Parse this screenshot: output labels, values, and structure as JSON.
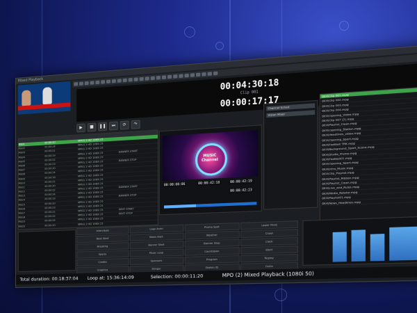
{
  "window": {
    "title": "Mixed Playback"
  },
  "timecodes": {
    "elapsed": "00:04:30:18",
    "clip_label": "Clip 001",
    "remaining": "00:00:17:17"
  },
  "transport": {
    "play": "▶",
    "stop": "■",
    "pause": "❚❚",
    "next": "⏭",
    "loop": "⟳",
    "skip": "↷"
  },
  "player": {
    "logo_line1": "MUSIC",
    "logo_line2": "Channel",
    "tc_in": "00:00:08:06",
    "tc_a": "00:00:42:18",
    "tc_b": "00:00:42:19",
    "tc_c": "00:00:42:23",
    "progress_fraction": 0.35
  },
  "playlist": [
    {
      "name": "MS01",
      "time": "00:00:20",
      "info": "MPEG 2 HD 1080i 25",
      "cue": "",
      "selected": true
    },
    {
      "name": "MS02",
      "time": "00:00:24",
      "info": "MPEG 2 HD 1080i 25",
      "cue": ""
    },
    {
      "name": "MS03",
      "time": "00:00:21",
      "info": "MPEG 2 HD 1080i 25",
      "cue": ""
    },
    {
      "name": "MS04",
      "time": "00:00:19",
      "info": "MPEG 2 HD 1080i 25",
      "cue": "BANNER START"
    },
    {
      "name": "MS05",
      "time": "00:00:22",
      "info": "MPEG 2 HD 1080i 25",
      "cue": ""
    },
    {
      "name": "MS06",
      "time": "00:00:23",
      "info": "MPEG 2 HD 1080i 25",
      "cue": "BANNER STOP"
    },
    {
      "name": "MS07",
      "time": "00:00:20",
      "info": "MPEG 2 HD 1080i 25",
      "cue": ""
    },
    {
      "name": "MS08",
      "time": "00:00:24",
      "info": "MPEG 2 HD 1080i 25",
      "cue": ""
    },
    {
      "name": "MS09",
      "time": "00:00:18",
      "info": "MPEG 2 HD 1080i 25",
      "cue": ""
    },
    {
      "name": "MS10",
      "time": "00:00:21",
      "info": "MPEG 2 HD 1080i 25",
      "cue": ""
    },
    {
      "name": "MS11",
      "time": "00:00:20",
      "info": "MPEG 2 HD 1080i 25",
      "cue": ""
    },
    {
      "name": "MS12",
      "time": "00:00:22",
      "info": "MPEG 2 HD 1080i 25",
      "cue": "BANNER START"
    },
    {
      "name": "MS13",
      "time": "00:00:24",
      "info": "MPEG 2 HD 1080i 25",
      "cue": ""
    },
    {
      "name": "MS14",
      "time": "00:00:19",
      "info": "MPEG 2 HD 1080i 25",
      "cue": "BANNER STOP"
    },
    {
      "name": "MS15",
      "time": "00:00:20",
      "info": "MPEG 2 HD 1080i 25",
      "cue": ""
    },
    {
      "name": "MS16",
      "time": "00:00:23",
      "info": "MPEG 2 HD 1080i 25",
      "cue": ""
    },
    {
      "name": "MS17",
      "time": "00:00:21",
      "info": "MPEG 2 HD 1080i 25",
      "cue": "NEXT START"
    },
    {
      "name": "MS18",
      "time": "00:00:22",
      "info": "MPEG 2 HD 1080i 25",
      "cue": "NEXT STOP"
    },
    {
      "name": "MS19",
      "time": "00:00:24",
      "info": "MPEG 2 HD 1080i 25",
      "cue": ""
    },
    {
      "name": "MS20",
      "time": "00:00:20",
      "info": "MPEG 2 HD 1080i 25",
      "cue": ""
    },
    {
      "name": "MS21",
      "time": "00:00:18",
      "info": "MPEG 2 HD 1080i 25",
      "cue": ""
    },
    {
      "name": "MS22",
      "time": "00:00:21",
      "info": "MPEG 2 HD 1080i 25",
      "cue": ""
    }
  ],
  "files": [
    "DEX\\Clip 001.mpg",
    "DEX\\Clip 002.mpg",
    "DEX\\Clip 003.mpg",
    "DEX\\Clip 004.mpg",
    "DEX\\Opening_Video.mpg",
    "DEX\\Clip 007 (2).mpg",
    "DEX\\Playlist_Clean.mpg",
    "DEX\\Opening_Station.mpg",
    "DEX\\Headlines_video.mpg",
    "DEX\\Opening_Sport.mpg",
    "DEX\\Football TRK.mpg",
    "DEX\\Background_Sport_Scene.mpg",
    "DEX\\Studio_Promo.mpg",
    "DEX\\Football01.mpg",
    "DEX\\Opening_Sport.mpg",
    "DEX\\Intro_Music.mpg",
    "DEX\\Clip_Playlist.mpg",
    "DEX\\Playlist_Ribbon.mpg",
    "DEX\\Playlist_Clean.mpg",
    "DEX\\Live_and_Rules.mpg",
    "DEX\\Media_Rotator.mpg",
    "DEX\\Playlist01.mpg",
    "DEX\\News_Headlines.mpg"
  ],
  "side_panel": [
    "Channel Sched",
    "Vision Mixer"
  ],
  "buttons": [
    "Interviews",
    "Logo Anim",
    "Promo Spot",
    "Lower Third",
    "Next Start",
    "News Alert",
    "Weather",
    "Crawl",
    "Breaking",
    "Banner Start",
    "Banner Stop",
    "Clock",
    "Sports",
    "Music Loop",
    "Countdown",
    "Ident",
    "Credits",
    "Sponsors",
    "Program",
    "Replay",
    "Graphics",
    "Stinger",
    "Station ID",
    "Outro"
  ],
  "meter_levels": [
    0.78,
    0.82,
    0.7,
    0.86
  ],
  "status": {
    "total": "Total duration: 00:18:37:04",
    "loop": "Loop at: 15:36:14:09",
    "selection": "Selection: 00:00:11:20",
    "mode": "MPO (2) Mixed Playback (1080i 50)"
  },
  "colors": {
    "selected_row": "#3fa34a",
    "accent_blue": "#2f6fc0"
  }
}
